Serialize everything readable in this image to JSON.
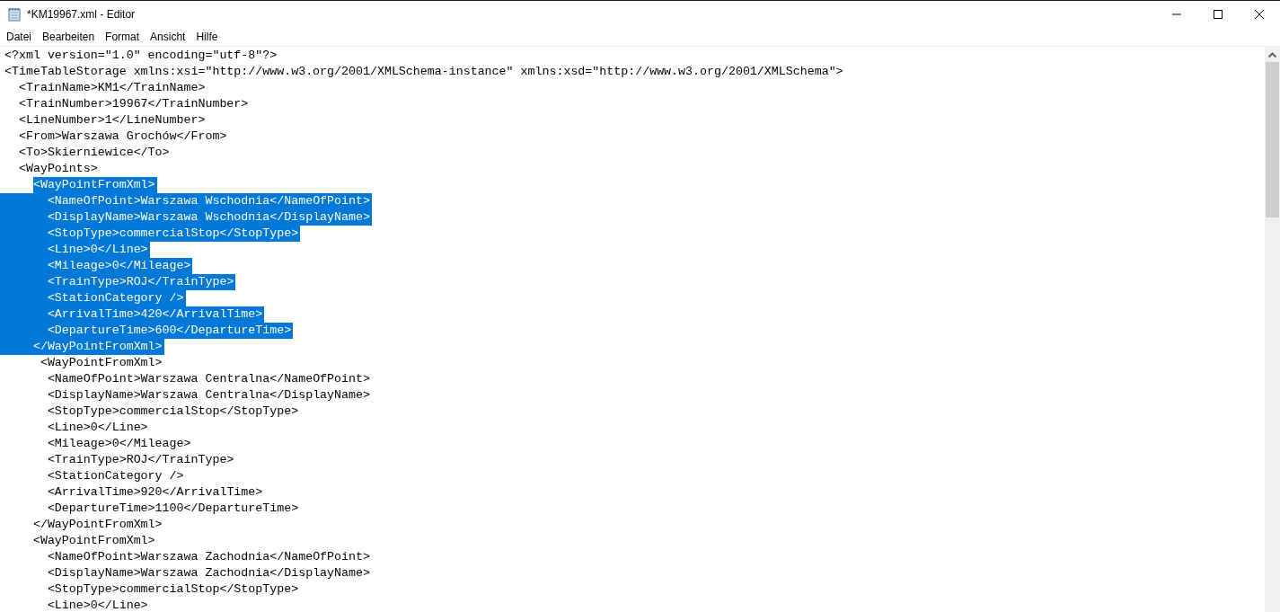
{
  "window": {
    "title": "*KM19967.xml - Editor"
  },
  "menu": [
    {
      "label": "Datei"
    },
    {
      "label": "Bearbeiten"
    },
    {
      "label": "Format"
    },
    {
      "label": "Ansicht"
    },
    {
      "label": "Hilfe"
    }
  ],
  "lines": [
    {
      "text": "<?xml version=\"1.0\" encoding=\"utf-8\"?>",
      "selected": false,
      "indent_selected": false
    },
    {
      "text": "<TimeTableStorage xmlns:xsi=\"http://www.w3.org/2001/XMLSchema-instance\" xmlns:xsd=\"http://www.w3.org/2001/XMLSchema\">",
      "selected": false,
      "indent_selected": false
    },
    {
      "text": "  <TrainName>KM1</TrainName>",
      "selected": false,
      "indent_selected": false
    },
    {
      "text": "  <TrainNumber>19967</TrainNumber>",
      "selected": false,
      "indent_selected": false
    },
    {
      "text": "  <LineNumber>1</LineNumber>",
      "selected": false,
      "indent_selected": false
    },
    {
      "text": "  <From>Warszawa Grochów</From>",
      "selected": false,
      "indent_selected": false
    },
    {
      "text": "  <To>Skierniewice</To>",
      "selected": false,
      "indent_selected": false
    },
    {
      "text": "  <WayPoints>",
      "selected": false,
      "indent_selected": false
    },
    {
      "text": "    <WayPointFromXml>",
      "selected": true,
      "indent_selected": false
    },
    {
      "text": "      <NameOfPoint>Warszawa Wschodnia</NameOfPoint>",
      "selected": true,
      "indent_selected": true
    },
    {
      "text": "      <DisplayName>Warszawa Wschodnia</DisplayName>",
      "selected": true,
      "indent_selected": true
    },
    {
      "text": "      <StopType>commercialStop</StopType>",
      "selected": true,
      "indent_selected": true
    },
    {
      "text": "      <Line>0</Line>",
      "selected": true,
      "indent_selected": true
    },
    {
      "text": "      <Mileage>0</Mileage>",
      "selected": true,
      "indent_selected": true
    },
    {
      "text": "      <TrainType>ROJ</TrainType>",
      "selected": true,
      "indent_selected": true
    },
    {
      "text": "      <StationCategory />",
      "selected": true,
      "indent_selected": true
    },
    {
      "text": "      <ArrivalTime>420</ArrivalTime>",
      "selected": true,
      "indent_selected": true
    },
    {
      "text": "      <DepartureTime>600</DepartureTime>",
      "selected": true,
      "indent_selected": true
    },
    {
      "text": "    </WayPointFromXml>",
      "selected": true,
      "indent_selected": true
    },
    {
      "text": "     <WayPointFromXml>",
      "selected": false,
      "indent_selected": false
    },
    {
      "text": "      <NameOfPoint>Warszawa Centralna</NameOfPoint>",
      "selected": false,
      "indent_selected": false
    },
    {
      "text": "      <DisplayName>Warszawa Centralna</DisplayName>",
      "selected": false,
      "indent_selected": false
    },
    {
      "text": "      <StopType>commercialStop</StopType>",
      "selected": false,
      "indent_selected": false
    },
    {
      "text": "      <Line>0</Line>",
      "selected": false,
      "indent_selected": false
    },
    {
      "text": "      <Mileage>0</Mileage>",
      "selected": false,
      "indent_selected": false
    },
    {
      "text": "      <TrainType>ROJ</TrainType>",
      "selected": false,
      "indent_selected": false
    },
    {
      "text": "      <StationCategory />",
      "selected": false,
      "indent_selected": false
    },
    {
      "text": "      <ArrivalTime>920</ArrivalTime>",
      "selected": false,
      "indent_selected": false
    },
    {
      "text": "      <DepartureTime>1100</DepartureTime>",
      "selected": false,
      "indent_selected": false
    },
    {
      "text": "    </WayPointFromXml>",
      "selected": false,
      "indent_selected": false
    },
    {
      "text": "    <WayPointFromXml>",
      "selected": false,
      "indent_selected": false
    },
    {
      "text": "      <NameOfPoint>Warszawa Zachodnia</NameOfPoint>",
      "selected": false,
      "indent_selected": false
    },
    {
      "text": "      <DisplayName>Warszawa Zachodnia</DisplayName>",
      "selected": false,
      "indent_selected": false
    },
    {
      "text": "      <StopType>commercialStop</StopType>",
      "selected": false,
      "indent_selected": false
    },
    {
      "text": "      <Line>0</Line>",
      "selected": false,
      "indent_selected": false
    }
  ]
}
